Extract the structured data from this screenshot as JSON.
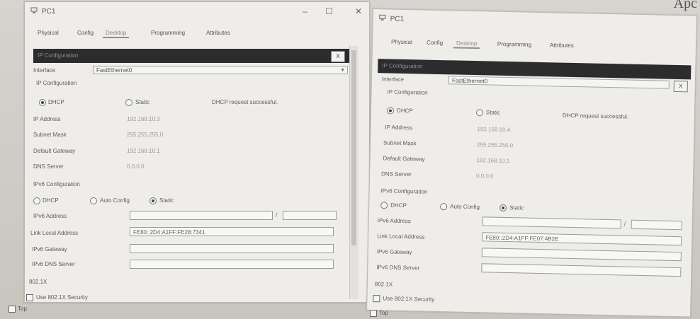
{
  "corner_text": "Apc",
  "windows": [
    {
      "title": "PC1",
      "controls": {
        "minimize": "–",
        "maximize": "☐",
        "close": "✕"
      },
      "tabs": [
        "Physical",
        "Config",
        "Desktop",
        "Programming",
        "Attributes"
      ],
      "active_tab": "Desktop",
      "panel_title": "IP Configuration",
      "panel_close": "X",
      "interface_label": "Interface",
      "interface_value": "FastEthernet0",
      "ip_config_label": "IP Configuration",
      "dhcp_label": "DHCP",
      "static_label": "Static",
      "dhcp_status": "DHCP request successful.",
      "ip_address_label": "IP Address",
      "ip_address_value": "192.168.10.3",
      "subnet_label": "Subnet Mask",
      "subnet_value": "255.255.255.0",
      "gateway_label": "Default Gateway",
      "gateway_value": "192.168.10.1",
      "dns_label": "DNS Server",
      "dns_value": "0.0.0.0",
      "ipv6_config_label": "IPv6 Configuration",
      "ipv6_dhcp_label": "DHCP",
      "ipv6_auto_label": "Auto Config",
      "ipv6_static_label": "Static",
      "ipv6_address_label": "IPv6 Address",
      "ipv6_address_value": "",
      "ipv6_prefix_value": "",
      "link_local_label": "Link Local Address",
      "link_local_value": "FE80::2D4:A1FF:FE28:7341",
      "ipv6_gateway_label": "IPv6 Gateway",
      "ipv6_gateway_value": "",
      "ipv6_dns_label": "IPv6 DNS Server",
      "ipv6_dns_value": "",
      "dot1x_label": "802.1X",
      "use_dot1x_label": "Use 802.1X Security",
      "top_label": "Top"
    },
    {
      "title": "PC1",
      "tabs": [
        "Physical",
        "Config",
        "Desktop",
        "Programming",
        "Attributes"
      ],
      "active_tab": "Desktop",
      "panel_title": "IP Configuration",
      "panel_close": "X",
      "interface_label": "Interface",
      "interface_value": "FastEthernet0",
      "ip_config_label": "IP Configuration",
      "dhcp_label": "DHCP",
      "static_label": "Static",
      "dhcp_status": "DHCP request successful.",
      "ip_address_label": "IP Address",
      "ip_address_value": "192.168.10.4",
      "subnet_label": "Subnet Mask",
      "subnet_value": "255.255.255.0",
      "gateway_label": "Default Gateway",
      "gateway_value": "192.168.10.1",
      "dns_label": "DNS Server",
      "dns_value": "0.0.0.0",
      "ipv6_config_label": "IPv6 Configuration",
      "ipv6_dhcp_label": "DHCP",
      "ipv6_auto_label": "Auto Config",
      "ipv6_static_label": "Static",
      "ipv6_address_label": "IPv6 Address",
      "ipv6_address_value": "",
      "ipv6_prefix_value": "",
      "link_local_label": "Link Local Address",
      "link_local_value": "FE80::2D4:A1FF:FE07:4B2E",
      "ipv6_gateway_label": "IPv6 Gateway",
      "ipv6_gateway_value": "",
      "ipv6_dns_label": "IPv6 DNS Server",
      "ipv6_dns_value": "",
      "dot1x_label": "802.1X",
      "use_dot1x_label": "Use 802.1X Security",
      "top_label": "Top"
    }
  ]
}
